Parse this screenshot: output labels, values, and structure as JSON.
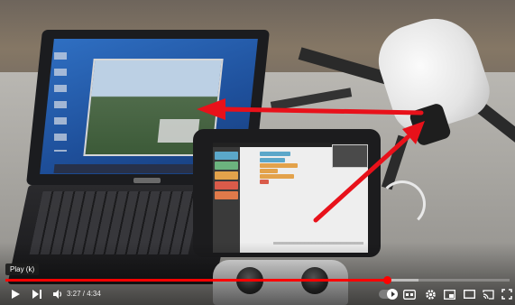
{
  "tooltip": {
    "text": "Play (k)"
  },
  "player": {
    "current_time": "3:27",
    "separator": " / ",
    "duration": "4:34",
    "progress_played": 0.757,
    "progress_buffered": 0.82,
    "settings_badge": "HD"
  },
  "controls": {
    "play": "play-icon",
    "next": "next-icon",
    "volume": "volume-icon",
    "autoplay": "autoplay-toggle",
    "subtitles": "cc-icon",
    "settings": "gear-icon",
    "miniplayer": "miniplayer-icon",
    "theater": "theater-icon",
    "cast": "cast-icon",
    "fullscreen": "fullscreen-icon"
  },
  "colors": {
    "progress": "#ff0000",
    "arrow": "#e8111a",
    "app_blocks": [
      "#5ba7c9",
      "#e3a24b",
      "#d95b4a"
    ]
  }
}
